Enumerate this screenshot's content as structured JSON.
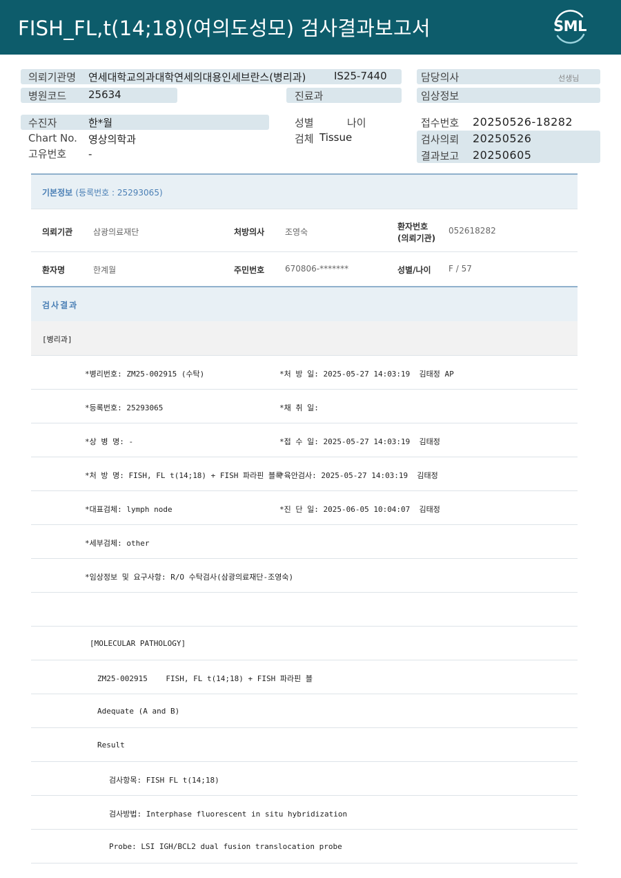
{
  "header": {
    "title": "FISH_FL,t(14;18)(여의도성모) 검사결과보고서",
    "logo_text": "SML"
  },
  "patient_info": {
    "institution_label": "의뢰기관명",
    "institution_value": "연세대학교의과대학연세의대용인세브란스(병리과)",
    "institution_code": "IS25-7440",
    "hospital_code_label": "병원코드",
    "hospital_code_value": "25634",
    "department_label": "진료과",
    "doctor_label": "담당의사",
    "doctor_suffix": "선생님",
    "clinical_label": "임상정보",
    "patient_label": "수진자",
    "patient_value": "한*월",
    "sex_label": "성별",
    "age_label": "나이",
    "receipt_label": "접수번호",
    "receipt_value": "20250526-18282",
    "chart_label": "Chart No.",
    "chart_value": "영상의학과",
    "specimen_label": "검체",
    "specimen_value": "Tissue",
    "request_label": "검사의뢰",
    "request_value": "20250526",
    "unique_label": "고유번호",
    "unique_value": "-",
    "report_label": "결과보고",
    "report_value": "20250605"
  },
  "basic_info": {
    "heading": "기본정보",
    "reg_no": "(등록번호 : 25293065)",
    "requester_label": "의뢰기관",
    "requester_value": "삼광의료재단",
    "prescriber_label": "처방의사",
    "prescriber_value": "조영숙",
    "patient_no_label_1": "환자번호",
    "patient_no_label_2": "(의뢰기관)",
    "patient_no_value": "052618282",
    "name_label": "환자명",
    "name_value": "한계월",
    "rrn_label": "주민번호",
    "rrn_value": "670806-*******",
    "sexage_label": "성별/나이",
    "sexage_value": "F / 57"
  },
  "results": {
    "heading": "검사결과",
    "dept": "[병리과]",
    "lines": [
      {
        "left": "*병리번호: ZM25-002915 (수탁)",
        "right": "*처 방 일: 2025-05-27 14:03:19  김태정 AP"
      },
      {
        "left": "*등록번호: 25293065",
        "right": "*채 취 일:"
      },
      {
        "left": "*상 병 명: -",
        "right": "*접 수 일: 2025-05-27 14:03:19  김태정"
      },
      {
        "left": "*처 방 명: FISH, FL t(14;18) + FISH 파라핀 블록",
        "right": "*육안검사: 2025-05-27 14:03:19  김태정"
      },
      {
        "left": "*대표검체: lymph node",
        "right": "*진 단 일: 2025-06-05 10:04:07  김태정"
      },
      {
        "left": "*세부검체: other",
        "right": ""
      },
      {
        "left": "*임상정보 및 요구사항: R/O 수탁검사(삼광의료재단-조영숙)",
        "right": ""
      },
      {
        "left": "",
        "right": ""
      }
    ],
    "molecular": [
      "[MOLECULAR PATHOLOGY]",
      "ZM25-002915    FISH, FL t(14;18) + FISH 파라핀 블",
      "Adequate (A and B)",
      "Result",
      "검사항목: FISH FL t(14;18)",
      "검사방법: Interphase fluorescent in situ hybridization",
      "Probe: LSI IGH/BCL2 dual fusion translocation probe"
    ]
  }
}
